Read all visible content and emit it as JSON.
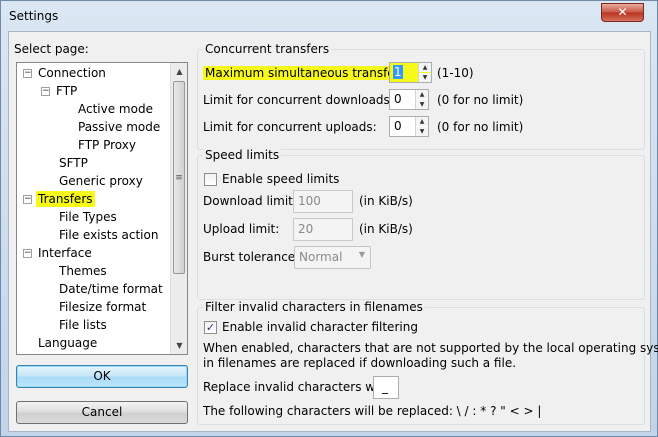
{
  "window": {
    "title": "Settings",
    "close_glyph": "✕"
  },
  "sidebar": {
    "label": "Select page:",
    "tree": [
      {
        "label": "Connection",
        "expander": "−"
      },
      {
        "label": "FTP",
        "expander": "−"
      },
      {
        "label": "Active mode"
      },
      {
        "label": "Passive mode"
      },
      {
        "label": "FTP Proxy"
      },
      {
        "label": "SFTP"
      },
      {
        "label": "Generic proxy"
      },
      {
        "label": "Transfers",
        "expander": "−",
        "highlighted": true
      },
      {
        "label": "File Types"
      },
      {
        "label": "File exists action"
      },
      {
        "label": "Interface",
        "expander": "−"
      },
      {
        "label": "Themes"
      },
      {
        "label": "Date/time format"
      },
      {
        "label": "Filesize format"
      },
      {
        "label": "File lists"
      },
      {
        "label": "Language"
      }
    ],
    "scroll": {
      "up": "▲",
      "down": "▼",
      "grip": "≡"
    }
  },
  "buttons": {
    "ok": "OK",
    "cancel": "Cancel"
  },
  "concurrent": {
    "title": "Concurrent transfers",
    "max_label": "Maximum simultaneous transfers:",
    "max_value": "1",
    "max_hint": "(1-10)",
    "downloads_label": "Limit for concurrent downloads:",
    "downloads_value": "0",
    "downloads_hint": "(0 for no limit)",
    "uploads_label": "Limit for concurrent uploads:",
    "uploads_value": "0",
    "uploads_hint": "(0 for no limit)",
    "spin_up": "▲",
    "spin_down": "▼"
  },
  "speed": {
    "title": "Speed limits",
    "enable_label": "Enable speed limits",
    "enable_checked": false,
    "download_label": "Download limit:",
    "download_value": "100",
    "download_unit": "(in KiB/s)",
    "upload_label": "Upload limit:",
    "upload_value": "20",
    "upload_unit": "(in KiB/s)",
    "burst_label": "Burst tolerance:",
    "burst_value": "Normal",
    "burst_arrow": "▼"
  },
  "filter": {
    "title": "Filter invalid characters in filenames",
    "enable_label": "Enable invalid character filtering",
    "enable_checked": true,
    "check_mark": "✓",
    "desc_line1": "When enabled, characters that are not supported by the local operating system",
    "desc_line2": "in filenames are replaced if downloading such a file.",
    "replace_label": "Replace invalid characters with:",
    "replace_value": "_",
    "chars_line": "The following characters will be replaced: \\ / : * ? \" < > |"
  },
  "colors": {
    "highlight": "#f6f91a",
    "selection": "#3399ff",
    "ok_border": "#3c7fb1"
  }
}
